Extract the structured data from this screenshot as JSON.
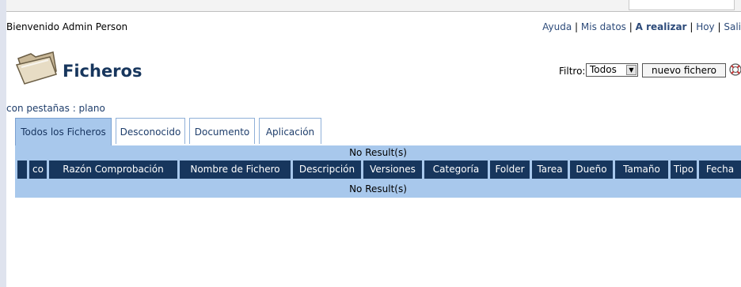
{
  "header": {
    "welcome": "Bienvenido Admin Person",
    "links": {
      "help": "Ayuda",
      "my_data": "Mis datos",
      "todo": "A realizar",
      "today": "Hoy",
      "exit": "Sali"
    },
    "separator": "|"
  },
  "page": {
    "title": "Ficheros",
    "icon": "folder-icon",
    "filter_label": "Filtro:",
    "filter_value": "Todos",
    "new_file_button": "nuevo fichero"
  },
  "tabs_caption": "con pestañas : plano",
  "tabs": [
    "Todos los Ficheros",
    "Desconocido",
    "Documento",
    "Aplicación"
  ],
  "active_tab": 0,
  "grid": {
    "top_message": "No Result(s)",
    "bottom_message": "No Result(s)",
    "columns": [
      "",
      "co",
      "Razón Comprobación",
      "Nombre de Fichero",
      "Descripción",
      "Versiones",
      "Categoría",
      "Folder",
      "Tarea",
      "Dueño",
      "Tamaño",
      "Tipo",
      "Fecha"
    ]
  },
  "colors": {
    "header_blue": "#17365d",
    "grid_light_blue": "#a8c8ec",
    "link_blue": "#2d4b7a"
  }
}
